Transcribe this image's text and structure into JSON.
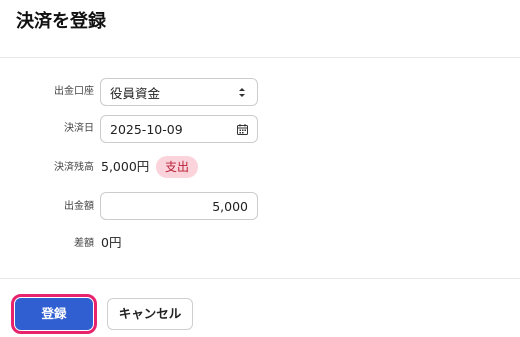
{
  "modal": {
    "title": "決済を登録"
  },
  "form": {
    "account": {
      "label": "出金口座",
      "value": "役員資金",
      "icon": "select-arrows-icon"
    },
    "date": {
      "label": "決済日",
      "value": "2025-10-09",
      "icon": "calendar-icon"
    },
    "balance": {
      "label": "決済残高",
      "value": "5,000円",
      "badge": "支出"
    },
    "amount": {
      "label": "出金額",
      "value": "5,000"
    },
    "difference": {
      "label": "差額",
      "value": "0円"
    }
  },
  "actions": {
    "submit_label": "登録",
    "cancel_label": "キャンセル"
  },
  "colors": {
    "primary": "#2f5fd0",
    "focus_ring": "#e8236d",
    "badge_bg": "#fbd3da",
    "badge_text": "#b8233a"
  }
}
